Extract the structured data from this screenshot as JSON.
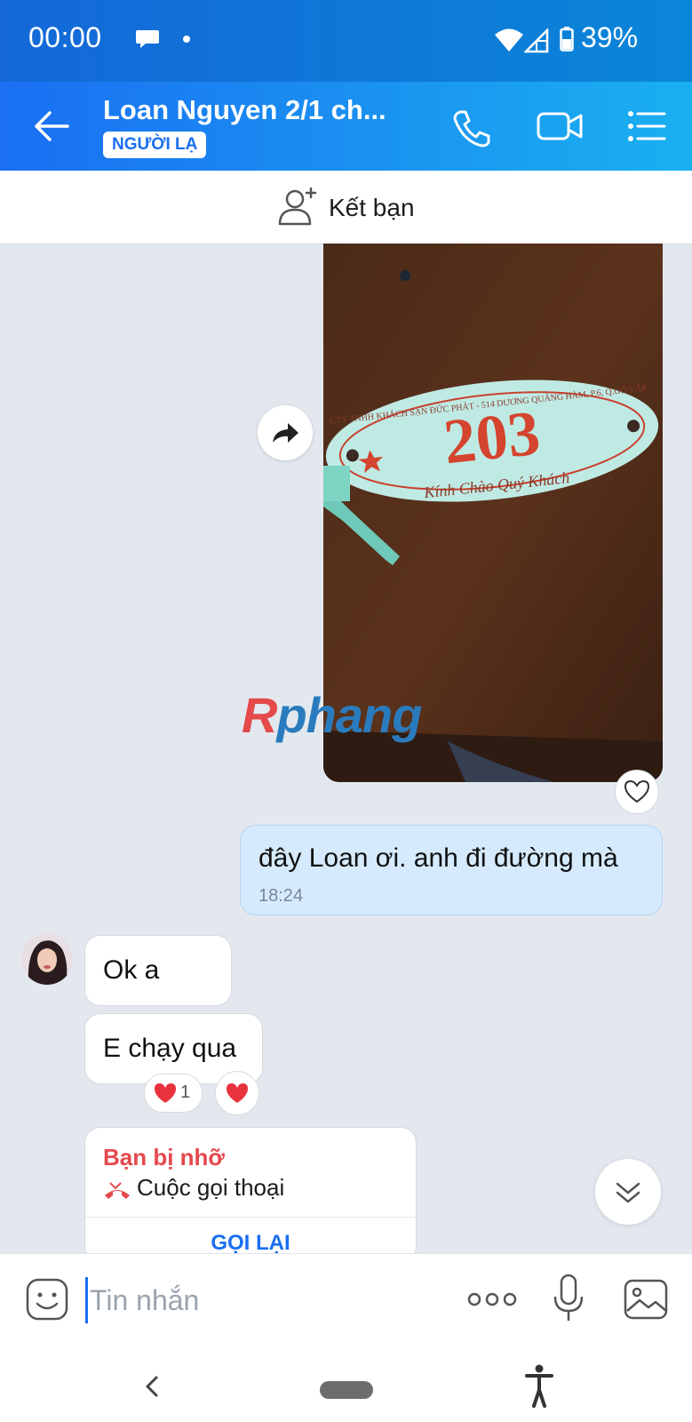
{
  "status_bar": {
    "time": "00:00",
    "battery_pct": "39%"
  },
  "header": {
    "contact_name": "Loan Nguyen 2/1 ch...",
    "badge": "NGƯỜI LẠ"
  },
  "friend_bar": {
    "label": "Kết bạn"
  },
  "image_message": {
    "key_tag_number": "203",
    "key_tag_top_text": "CTY TNHH KHÁCH SẠN ĐỨC PHÁT - 514 DƯƠNG QUẢNG HÀM, P.6, Q.GÒ VẤP",
    "key_tag_bottom_text": "Kính Chào Quý Khách"
  },
  "watermark": {
    "r": "R",
    "rest": "phang"
  },
  "messages": {
    "sent": {
      "text": "đây Loan ơi. anh đi đường mà",
      "time": "18:24"
    },
    "received": [
      {
        "text": "Ok a"
      },
      {
        "text": "E chạy qua"
      }
    ],
    "reaction_count": "1"
  },
  "call_card": {
    "status": "Bạn bị nhỡ",
    "type": "Cuộc gọi thoại",
    "action": "GỌI LẠI"
  },
  "input": {
    "placeholder": "Tin nhắn"
  },
  "colors": {
    "accent": "#1a6ff2",
    "missed": "#e5484d",
    "sent_bubble": "#d5ebfd",
    "background": "#e3e8ef"
  }
}
